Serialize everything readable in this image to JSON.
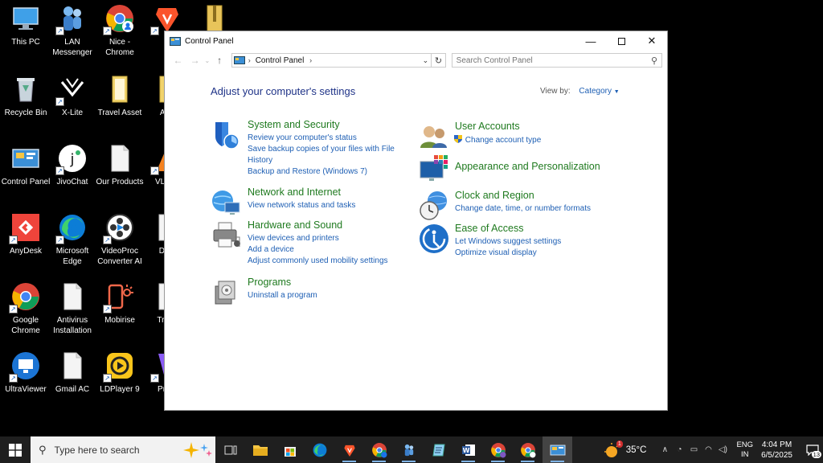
{
  "desktop": {
    "icons": [
      {
        "label": "This PC",
        "icon": "computer-icon"
      },
      {
        "label": "LAN Messenger",
        "icon": "lan-messenger-icon"
      },
      {
        "label": "Nice - Chrome",
        "icon": "chrome-profile-icon"
      },
      {
        "label": "B",
        "icon": "brave-icon"
      },
      {
        "label": "",
        "icon": "zip-folder-icon"
      },
      {
        "label": "Recycle Bin",
        "icon": "recycle-bin-icon"
      },
      {
        "label": "X-Lite",
        "icon": "x-lite-icon"
      },
      {
        "label": "Travel Asset",
        "icon": "folder-icon"
      },
      {
        "label": "AI F",
        "icon": "folder-icon"
      },
      {
        "label": "Control Panel",
        "icon": "control-panel-icon"
      },
      {
        "label": "JivoChat",
        "icon": "jivochat-icon"
      },
      {
        "label": "Our Products",
        "icon": "document-icon"
      },
      {
        "label": "VLC pl",
        "icon": "vlc-icon"
      },
      {
        "label": "AnyDesk",
        "icon": "anydesk-icon"
      },
      {
        "label": "Microsoft Edge",
        "icon": "edge-icon"
      },
      {
        "label": "VideoProc Converter AI",
        "icon": "videoproc-icon"
      },
      {
        "label": "Dest",
        "icon": "document-icon"
      },
      {
        "label": "Google Chrome",
        "icon": "chrome-icon"
      },
      {
        "label": "Antivirus Installation",
        "icon": "document-icon"
      },
      {
        "label": "Mobirise",
        "icon": "mobirise-icon"
      },
      {
        "label": "Trav t",
        "icon": "document-icon"
      },
      {
        "label": "UltraViewer",
        "icon": "ultraviewer-icon"
      },
      {
        "label": "Gmail AC",
        "icon": "document-icon"
      },
      {
        "label": "LDPlayer 9",
        "icon": "ldplayer-icon"
      },
      {
        "label": "Prote",
        "icon": "proton-icon"
      }
    ]
  },
  "window": {
    "title": "Control Panel",
    "breadcrumb": "Control Panel",
    "search_placeholder": "Search Control Panel",
    "heading": "Adjust your computer's settings",
    "view_by_label": "View by:",
    "view_by_value": "Category",
    "categories": {
      "system": {
        "title": "System and Security",
        "links": [
          "Review your computer's status",
          "Save backup copies of your files with File History",
          "Backup and Restore (Windows 7)"
        ]
      },
      "network": {
        "title": "Network and Internet",
        "links": [
          "View network status and tasks"
        ]
      },
      "hardware": {
        "title": "Hardware and Sound",
        "links": [
          "View devices and printers",
          "Add a device",
          "Adjust commonly used mobility settings"
        ]
      },
      "programs": {
        "title": "Programs",
        "links": [
          "Uninstall a program"
        ]
      },
      "users": {
        "title": "User Accounts",
        "links": [
          "Change account type"
        ]
      },
      "appearance": {
        "title": "Appearance and Personalization",
        "links": []
      },
      "clock": {
        "title": "Clock and Region",
        "links": [
          "Change date, time, or number formats"
        ]
      },
      "ease": {
        "title": "Ease of Access",
        "links": [
          "Let Windows suggest settings",
          "Optimize visual display"
        ]
      }
    }
  },
  "taskbar": {
    "search_placeholder": "Type here to search",
    "weather_temp": "35°C",
    "weather_badge": "1",
    "lang_line1": "ENG",
    "lang_line2": "IN",
    "time": "4:04 PM",
    "date": "6/5/2025",
    "notification_count": "13",
    "colors": {
      "accent": "#0078d7",
      "bar": "#1f1f1f"
    }
  }
}
